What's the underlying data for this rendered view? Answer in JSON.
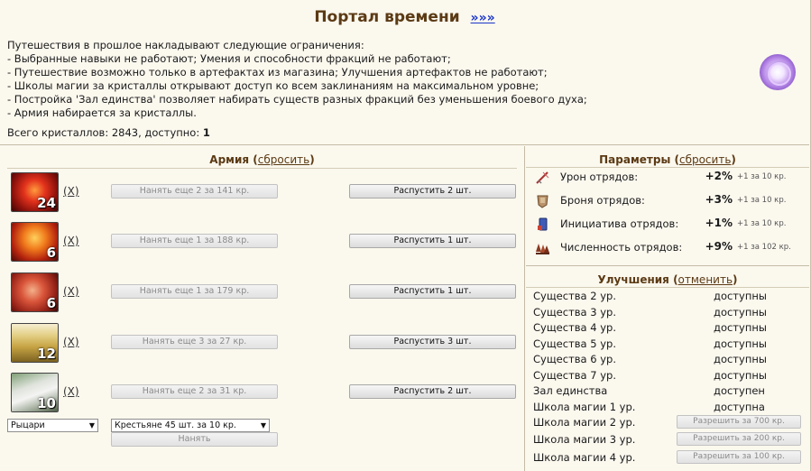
{
  "header": {
    "title": "Портал времени",
    "title_link": "»»»",
    "intro_lines": [
      "Путешествия в прошлое накладывают следующие ограничения:",
      "- Выбранные навыки не работают; Умения и способности фракций не работают;",
      "- Путешествие возможно только в артефактах из магазина; Улучшения артефактов не работают;",
      "- Школы магии за кристаллы открывают доступ ко всем заклинаниям на максимальном уровне;",
      "- Постройка 'Зал единства' позволяет набирать существ разных фракций без уменьшения боевого духа;",
      "- Армия набирается за кристаллы."
    ],
    "total_prefix": "Всего кристаллов: 2843, доступно: ",
    "total_available": "1"
  },
  "army": {
    "title": "Армия",
    "reset_open": "(",
    "reset_label": "сбросить",
    "reset_close": ")",
    "remove_label": "(X)",
    "units": [
      {
        "count": "24",
        "hire": "Нанять еще 2 за 141 кр.",
        "dismiss": "Распустить 2 шт.",
        "art": "red-demon"
      },
      {
        "count": "6",
        "hire": "Нанять еще 1 за 188 кр.",
        "dismiss": "Распустить 1 шт.",
        "art": "fire-demon"
      },
      {
        "count": "6",
        "hire": "Нанять еще 1 за 179 кр.",
        "dismiss": "Распустить 1 шт.",
        "art": "red-horned"
      },
      {
        "count": "12",
        "hire": "Нанять еще 3 за 27 кр.",
        "dismiss": "Распустить 3 шт.",
        "art": "golden-knight"
      },
      {
        "count": "10",
        "hire": "Нанять еще 2 за 31 кр.",
        "dismiss": "Распустить 2 шт.",
        "art": "white-wolf"
      }
    ],
    "faction_select": "Рыцари",
    "unit_select": "Крестьяне 45 шт. за 10 кр.",
    "hire_button": "Нанять"
  },
  "params": {
    "title": "Параметры",
    "reset_open": "(",
    "reset_label": "сбросить",
    "reset_close": ")",
    "rows": [
      {
        "label": "Урон отрядов:",
        "value": "+2%",
        "note": "+1 за 10 кр.",
        "icon": "sword-icon"
      },
      {
        "label": "Броня отрядов:",
        "value": "+3%",
        "note": "+1 за 10 кр.",
        "icon": "armor-icon"
      },
      {
        "label": "Инициатива отрядов:",
        "value": "+1%",
        "note": "+1 за 10 кр.",
        "icon": "initiative-icon"
      },
      {
        "label": "Численность отрядов:",
        "value": "+9%",
        "note": "+1 за 102 кр.",
        "icon": "troops-icon"
      }
    ]
  },
  "upgrades": {
    "title": "Улучшения",
    "cancel_open": "(",
    "cancel_label": "отменить",
    "cancel_close": ")",
    "rows": [
      {
        "name": "Существа 2 ур.",
        "status": "доступны"
      },
      {
        "name": "Существа 3 ур.",
        "status": "доступны"
      },
      {
        "name": "Существа 4 ур.",
        "status": "доступны"
      },
      {
        "name": "Существа 5 ур.",
        "status": "доступны"
      },
      {
        "name": "Существа 6 ур.",
        "status": "доступны"
      },
      {
        "name": "Существа 7 ур.",
        "status": "доступны"
      },
      {
        "name": "Зал единства",
        "status": "доступен"
      },
      {
        "name": "Школа магии 1 ур.",
        "status": "доступна"
      },
      {
        "name": "Школа магии 2 ур.",
        "button": "Разрешить за 700 кр."
      },
      {
        "name": "Школа магии 3 ур.",
        "button": "Разрешить за 200 кр."
      },
      {
        "name": "Школа магии 4 ур.",
        "button": "Разрешить за 100 кр."
      }
    ]
  },
  "colors": {
    "background": "#fbf8ee",
    "title_brown": "#5b3a14",
    "link_blue": "#1a35c8"
  }
}
